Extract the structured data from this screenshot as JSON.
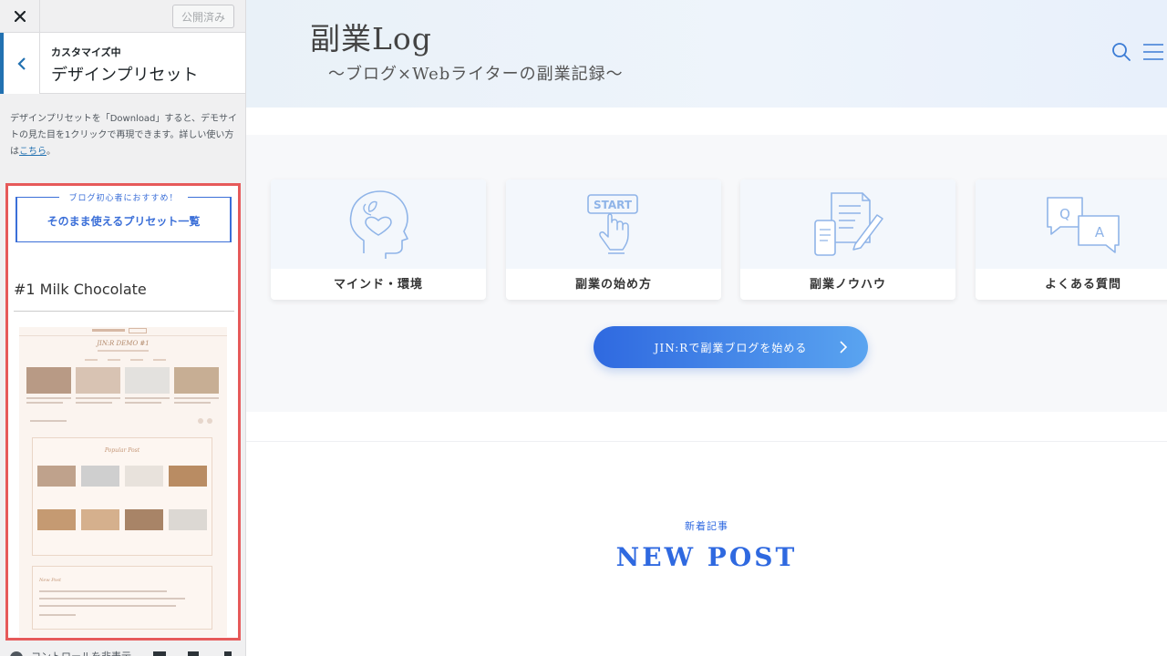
{
  "sidebar": {
    "close_icon": "close-icon",
    "publish_label": "公開済み",
    "header": {
      "subtitle": "カスタマイズ中",
      "title": "デザインプリセット",
      "back_icon": "chevron-left-icon"
    },
    "description": {
      "text": "デザインプリセットを「Download」すると、デモサイトの見た目を1クリックで再現できます。詳しい使い方は",
      "link_label": "こちら",
      "suffix": "。"
    },
    "preset_panel": {
      "cta_small": "ブログ初心者におすすめ！",
      "cta_main": "そのまま使えるプリセット一覧",
      "preset_name": "#1 Milk Chocolate",
      "preview": {
        "logo": "JIN:R DEMO #1",
        "popular_label": "Popular Post",
        "new_label": "New Post"
      }
    },
    "footer": {
      "label": "コントロールを非表示"
    }
  },
  "preview": {
    "site": {
      "logo": "副業Log",
      "tagline": "～ブログ×Webライターの副業記録～",
      "search_icon": "search-icon",
      "menu_icon": "hamburger-menu-icon"
    },
    "categories": [
      {
        "label": "マインド・環境",
        "icon": "head-leaf-icon"
      },
      {
        "label": "副業の始め方",
        "icon": "start-button-icon"
      },
      {
        "label": "副業ノウハウ",
        "icon": "document-pen-icon"
      },
      {
        "label": "よくある質問",
        "icon": "qa-bubbles-icon"
      }
    ],
    "cta_button": {
      "label": "JIN:Rで副業ブログを始める",
      "icon": "chevron-right-icon"
    },
    "new_post": {
      "subtitle": "新着記事",
      "title": "NEW POST"
    }
  },
  "colors": {
    "accent": "#2f69e0",
    "wp_blue": "#2271b1",
    "highlight_border": "#e65a5a",
    "header_bg": "#eaf2f9"
  }
}
